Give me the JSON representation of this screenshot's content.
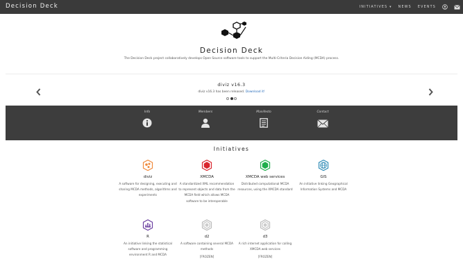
{
  "navbar": {
    "brand": "Decision Deck",
    "links": [
      "INITIATIVES ▾",
      "NEWS",
      "EVENTS"
    ]
  },
  "hero": {
    "title": "Decision Deck",
    "tagline": "The Decision Deck project collaboratively develops Open Source software tools to support the Multi-Criteria Decision Aiding (MCDA) process."
  },
  "carousel": {
    "title": "diviz v16.3",
    "text": "diviz v16.3 has been released.",
    "link": "Download it!",
    "slide_count": 3,
    "active_slide": 2
  },
  "info_band": {
    "items": [
      {
        "label": "Info",
        "icon": "info-circle-icon"
      },
      {
        "label": "Members",
        "icon": "person-icon"
      },
      {
        "label": "Manifesto",
        "icon": "document-icon"
      },
      {
        "label": "Contact",
        "icon": "envelope-icon"
      }
    ]
  },
  "initiatives": {
    "title": "Initiatives",
    "items": [
      {
        "name": "diviz",
        "desc": "A software for designing, executing and sharing MCDA methods, algorithms and experiments",
        "status": "",
        "color": "#f08a3c"
      },
      {
        "name": "XMCDA",
        "desc": "A standardized XML recommendation to represent objects and data from the MCDA field which allows MCDA software to be interoperable",
        "status": "",
        "color": "#d9262e"
      },
      {
        "name": "XMCDA web services",
        "desc": "Distributed computational MCDA resources, using the XMCDA standard",
        "status": "",
        "color": "#1fae4b"
      },
      {
        "name": "GIS",
        "desc": "An initiative linking Geographical Information Systems and MCDA",
        "status": "",
        "color": "#2e8bb6"
      },
      {
        "name": "R",
        "desc": "An initiative linking the statistical software and programming environment R and MCDA",
        "status": "",
        "color": "#6b3fa0"
      },
      {
        "name": "d2",
        "desc": "A software containing several MCDA methods",
        "status": "[FROZEN]",
        "color": "#bbbbbb"
      },
      {
        "name": "d3",
        "desc": "A rich internet application for calling XMCDA web services",
        "status": "[FROZEN]",
        "color": "#bbbbbb"
      }
    ]
  },
  "colors": {
    "navbar": "#3a3a3a",
    "band": "#3d3d3d",
    "link": "#2a6ebb"
  }
}
